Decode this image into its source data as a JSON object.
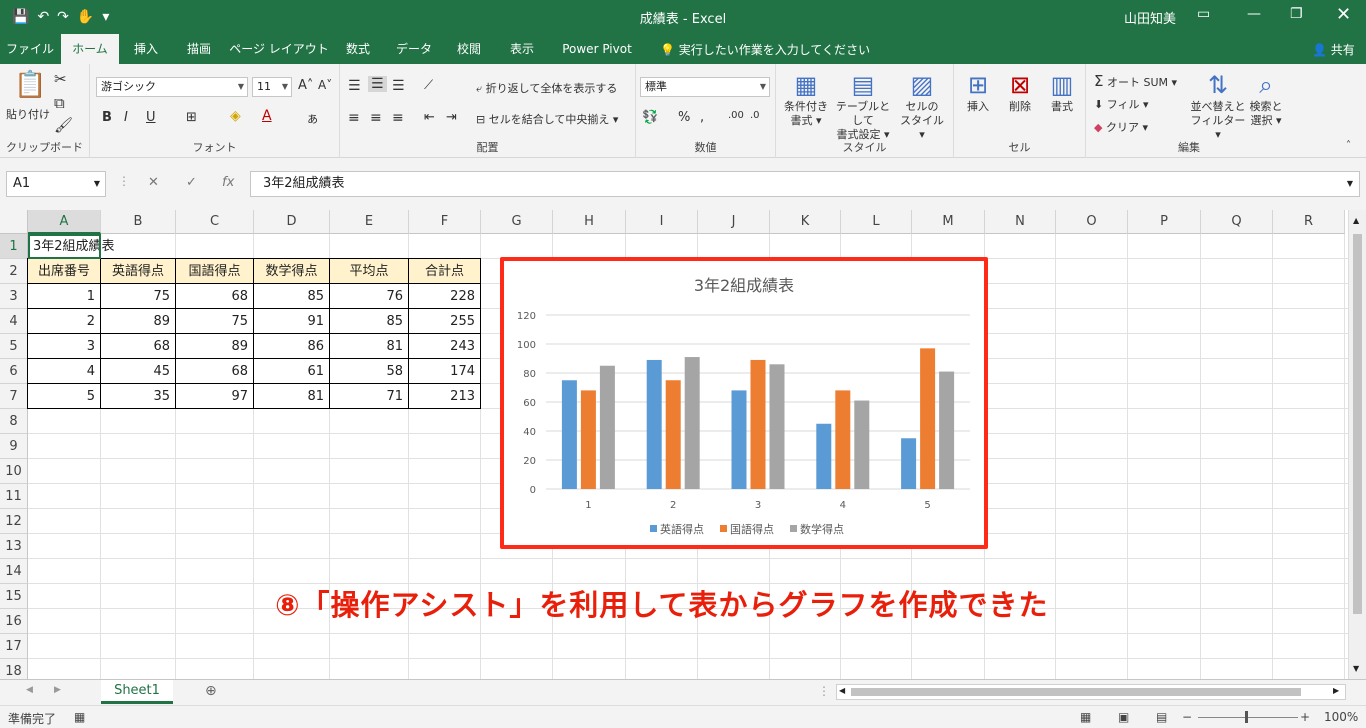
{
  "titlebar": {
    "title": "成績表  -  Excel",
    "user": "山田知美",
    "qat": [
      "💾",
      "↶",
      "↷",
      "✋",
      "▾"
    ]
  },
  "tabs": [
    "ファイル",
    "ホーム",
    "挿入",
    "描画",
    "ページ レイアウト",
    "数式",
    "データ",
    "校閲",
    "表示",
    "Power Pivot"
  ],
  "tell_me": "実行したい作業を入力してください",
  "share": "共有",
  "ribbon": {
    "clipboard": {
      "paste": "貼り付け",
      "label": "クリップボード"
    },
    "font": {
      "name": "游ゴシック",
      "size": "11",
      "bold": "B",
      "italic": "I",
      "underline": "U",
      "label": "フォント"
    },
    "alignment": {
      "wrap": "折り返して全体を表示する",
      "merge": "セルを結合して中央揃え",
      "label": "配置"
    },
    "number": {
      "format": "標準",
      "label": "数値"
    },
    "styles": {
      "conditional": [
        "条件付き",
        "書式 ▾"
      ],
      "table": [
        "テーブルとして",
        "書式設定 ▾"
      ],
      "cell": [
        "セルの",
        "スタイル ▾"
      ],
      "label": "スタイル"
    },
    "cells": {
      "insert": "挿入",
      "delete": "削除",
      "format": "書式",
      "label": "セル"
    },
    "editing": {
      "autosum": "オート SUM",
      "fill": "フィル",
      "clear": "クリア",
      "sort": [
        "並べ替えと",
        "フィルター ▾"
      ],
      "find": [
        "検索と",
        "選択 ▾"
      ],
      "label": "編集"
    }
  },
  "formula_bar": {
    "namebox": "A1",
    "formula": "3年2組成績表"
  },
  "columns": [
    "A",
    "B",
    "C",
    "D",
    "E",
    "F",
    "G",
    "H",
    "I",
    "J",
    "K",
    "L",
    "M",
    "N",
    "O",
    "P",
    "Q",
    "R"
  ],
  "rows": [
    "1",
    "2",
    "3",
    "4",
    "5",
    "6",
    "7",
    "8",
    "9",
    "10",
    "11",
    "12",
    "13",
    "14",
    "15",
    "16",
    "17",
    "18"
  ],
  "sheet": {
    "title": "3年2組成績表",
    "headers": [
      "出席番号",
      "英語得点",
      "国語得点",
      "数学得点",
      "平均点",
      "合計点"
    ],
    "data": [
      [
        "1",
        "75",
        "68",
        "85",
        "76",
        "228"
      ],
      [
        "2",
        "89",
        "75",
        "91",
        "85",
        "255"
      ],
      [
        "3",
        "68",
        "89",
        "86",
        "81",
        "243"
      ],
      [
        "4",
        "45",
        "68",
        "61",
        "58",
        "174"
      ],
      [
        "5",
        "35",
        "97",
        "81",
        "71",
        "213"
      ]
    ]
  },
  "chart_data": {
    "type": "bar",
    "title": "3年2組成績表",
    "categories": [
      "1",
      "2",
      "3",
      "4",
      "5"
    ],
    "series": [
      {
        "name": "英語得点",
        "values": [
          75,
          89,
          68,
          45,
          35
        ],
        "color": "#5b9bd5"
      },
      {
        "name": "国語得点",
        "values": [
          68,
          75,
          89,
          68,
          97
        ],
        "color": "#ed7d31"
      },
      {
        "name": "数学得点",
        "values": [
          85,
          91,
          86,
          61,
          81
        ],
        "color": "#a5a5a5"
      }
    ],
    "ylim": [
      0,
      120
    ],
    "yticks": [
      0,
      20,
      40,
      60,
      80,
      100,
      120
    ],
    "grid": true,
    "legend": "bottom"
  },
  "annotation": "⑧「操作アシスト」を利用して表からグラフを作成できた",
  "sheet_tab": "Sheet1",
  "status": {
    "ready": "準備完了",
    "zoom": "100%"
  }
}
